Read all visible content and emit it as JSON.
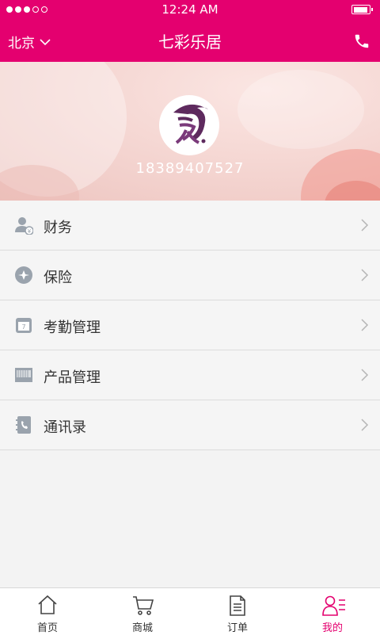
{
  "status_bar": {
    "time": "12:24 AM"
  },
  "navbar": {
    "city": "北京",
    "title": "七彩乐居"
  },
  "profile": {
    "phone": "18389407527"
  },
  "menu": [
    {
      "label": "财务",
      "icon": "finance-user-icon"
    },
    {
      "label": "保险",
      "icon": "insurance-icon"
    },
    {
      "label": "考勤管理",
      "icon": "calendar-icon"
    },
    {
      "label": "产品管理",
      "icon": "product-icon"
    },
    {
      "label": "通讯录",
      "icon": "contacts-icon"
    }
  ],
  "tabs": [
    {
      "label": "首页",
      "icon": "home-icon"
    },
    {
      "label": "商城",
      "icon": "cart-icon"
    },
    {
      "label": "订单",
      "icon": "document-icon"
    },
    {
      "label": "我的",
      "icon": "profile-list-icon",
      "active": true
    }
  ],
  "colors": {
    "accent": "#e4006f",
    "background": "#f3f3f3",
    "menu_icon": "#9aa3ad"
  }
}
